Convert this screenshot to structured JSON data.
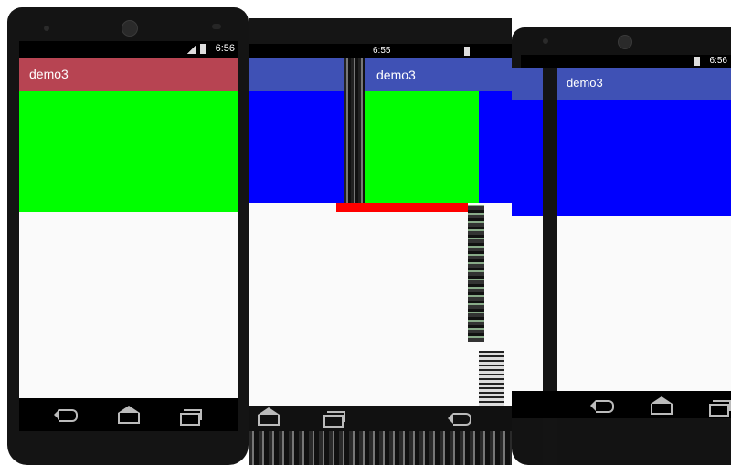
{
  "screens": [
    {
      "status_time": "6:56",
      "app_title": "demo3",
      "toolbar_color": "#b74452"
    },
    {
      "status_time": "6:55",
      "app_title": "demo3",
      "toolbar_color": "#3f51b5"
    },
    {
      "status_time": "6:56",
      "app_title": "demo3",
      "toolbar_color": "#3f51b5"
    }
  ],
  "colors": {
    "green": "#00ff00",
    "blue": "#0000ff",
    "red": "#ff0000",
    "background": "#fafafa"
  },
  "icons": [
    "signal-icon",
    "battery-icon",
    "back-icon",
    "home-icon",
    "recent-apps-icon"
  ]
}
